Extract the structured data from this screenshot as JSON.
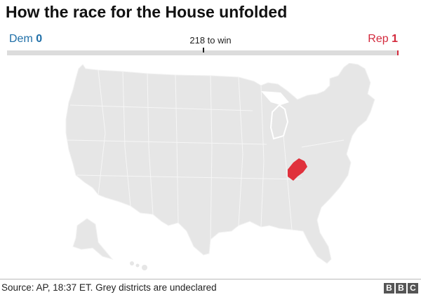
{
  "title": "How the race for the House unfolded",
  "tally": {
    "dem_label": "Dem",
    "dem_count": "0",
    "rep_label": "Rep",
    "rep_count": "1",
    "to_win_label": "218 to win",
    "dem_seats": 0,
    "rep_seats": 1,
    "total_seats": 435
  },
  "map": {
    "undeclared_color": "#e6e6e6",
    "border_color": "#f7f7f7",
    "dem_color": "#2e7cb8",
    "rep_color": "#e0313c",
    "called_districts": [
      {
        "state": "Kentucky",
        "district": "Kentucky 5th",
        "winner": "Rep"
      }
    ]
  },
  "colors": {
    "dem": "#1f6fa8",
    "rep": "#d3293c",
    "bar_track": "#dcdcdc"
  },
  "footer": {
    "source": "Source: AP, 18:37 ET. Grey districts are undeclared",
    "logo_letters": [
      "B",
      "B",
      "C"
    ]
  }
}
